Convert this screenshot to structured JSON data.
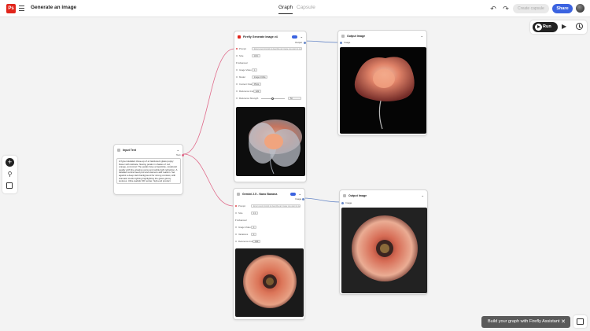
{
  "app": {
    "logo_text": "Ps",
    "title": "Generate an image"
  },
  "tabs": [
    {
      "label": "Graph",
      "active": true
    },
    {
      "label": "Capsule",
      "active": false
    }
  ],
  "header": {
    "create_capsule_label": "Create capsule",
    "share_label": "Share",
    "undo_icon": "undo-icon",
    "redo_icon": "redo-icon"
  },
  "toolbar": {
    "run_label": "Run"
  },
  "assistant": {
    "label": "Build your graph with Firefly Assistant",
    "close_glyph": "✕"
  },
  "nodes": {
    "input_text": {
      "title": "Input Text",
      "port": "Text",
      "prompt": "A hyper-detailed close-up of a translucent glass poppy flower with delicate, flowing petals in shades of red, orange, and coral. The petals have a liquid-like, sculptural quality with fine glowing veins and subtle light refraction. A detailed central seed pod and stamens add realism. Set against a deep dark background for strong contrast, with dramatic studio lighting highlighting the glass glossy textures. Ultra-realistic 3D render, high-end product photography style, cinematic lighting, sharp focus, elegant and surreal botanical design"
    },
    "firefly": {
      "title": "Firefly Generate Image v4",
      "output_port": "Output",
      "rows": [
        {
          "label": "Prompt",
          "type": "field",
          "value": "Enter a text prompt to describe an image you want to generate..."
        },
        {
          "label": "Size",
          "type": "chip",
          "value": "16:9"
        },
        {
          "label": "Advanced",
          "type": "none",
          "value": ""
        },
        {
          "label": "Image Video",
          "type": "chip",
          "value": "1"
        },
        {
          "label": "Model",
          "type": "chip",
          "value": "Image 4 Ultra"
        },
        {
          "label": "Content Class",
          "type": "chip",
          "value": "Photo"
        },
        {
          "label": "Reference Image",
          "type": "chip",
          "value": "Add"
        },
        {
          "label": "Reference Strength",
          "type": "slider",
          "value": "50"
        }
      ]
    },
    "gemini": {
      "title": "Gemini 2.5 - Nano Banana",
      "output_port": "Image",
      "rows": [
        {
          "label": "Prompt",
          "type": "field",
          "value": "Enter a text prompt to describe an image you want to generate..."
        },
        {
          "label": "Size",
          "type": "chip",
          "value": "1:1"
        },
        {
          "label": "Advanced",
          "type": "none",
          "value": ""
        },
        {
          "label": "Image Video",
          "type": "chip",
          "value": "1"
        },
        {
          "label": "Variations",
          "type": "chip",
          "value": "1"
        },
        {
          "label": "Reference Image",
          "type": "chip",
          "value": "Add"
        }
      ]
    },
    "output_top": {
      "title": "Output Image",
      "port": "Image"
    },
    "output_bottom": {
      "title": "Output Image",
      "port": "Image"
    }
  },
  "colors": {
    "accent": "#3b63e0",
    "brand": "#e1251b",
    "wire_pink": "#e06a8a",
    "wire_blue": "#6a8ac8"
  }
}
